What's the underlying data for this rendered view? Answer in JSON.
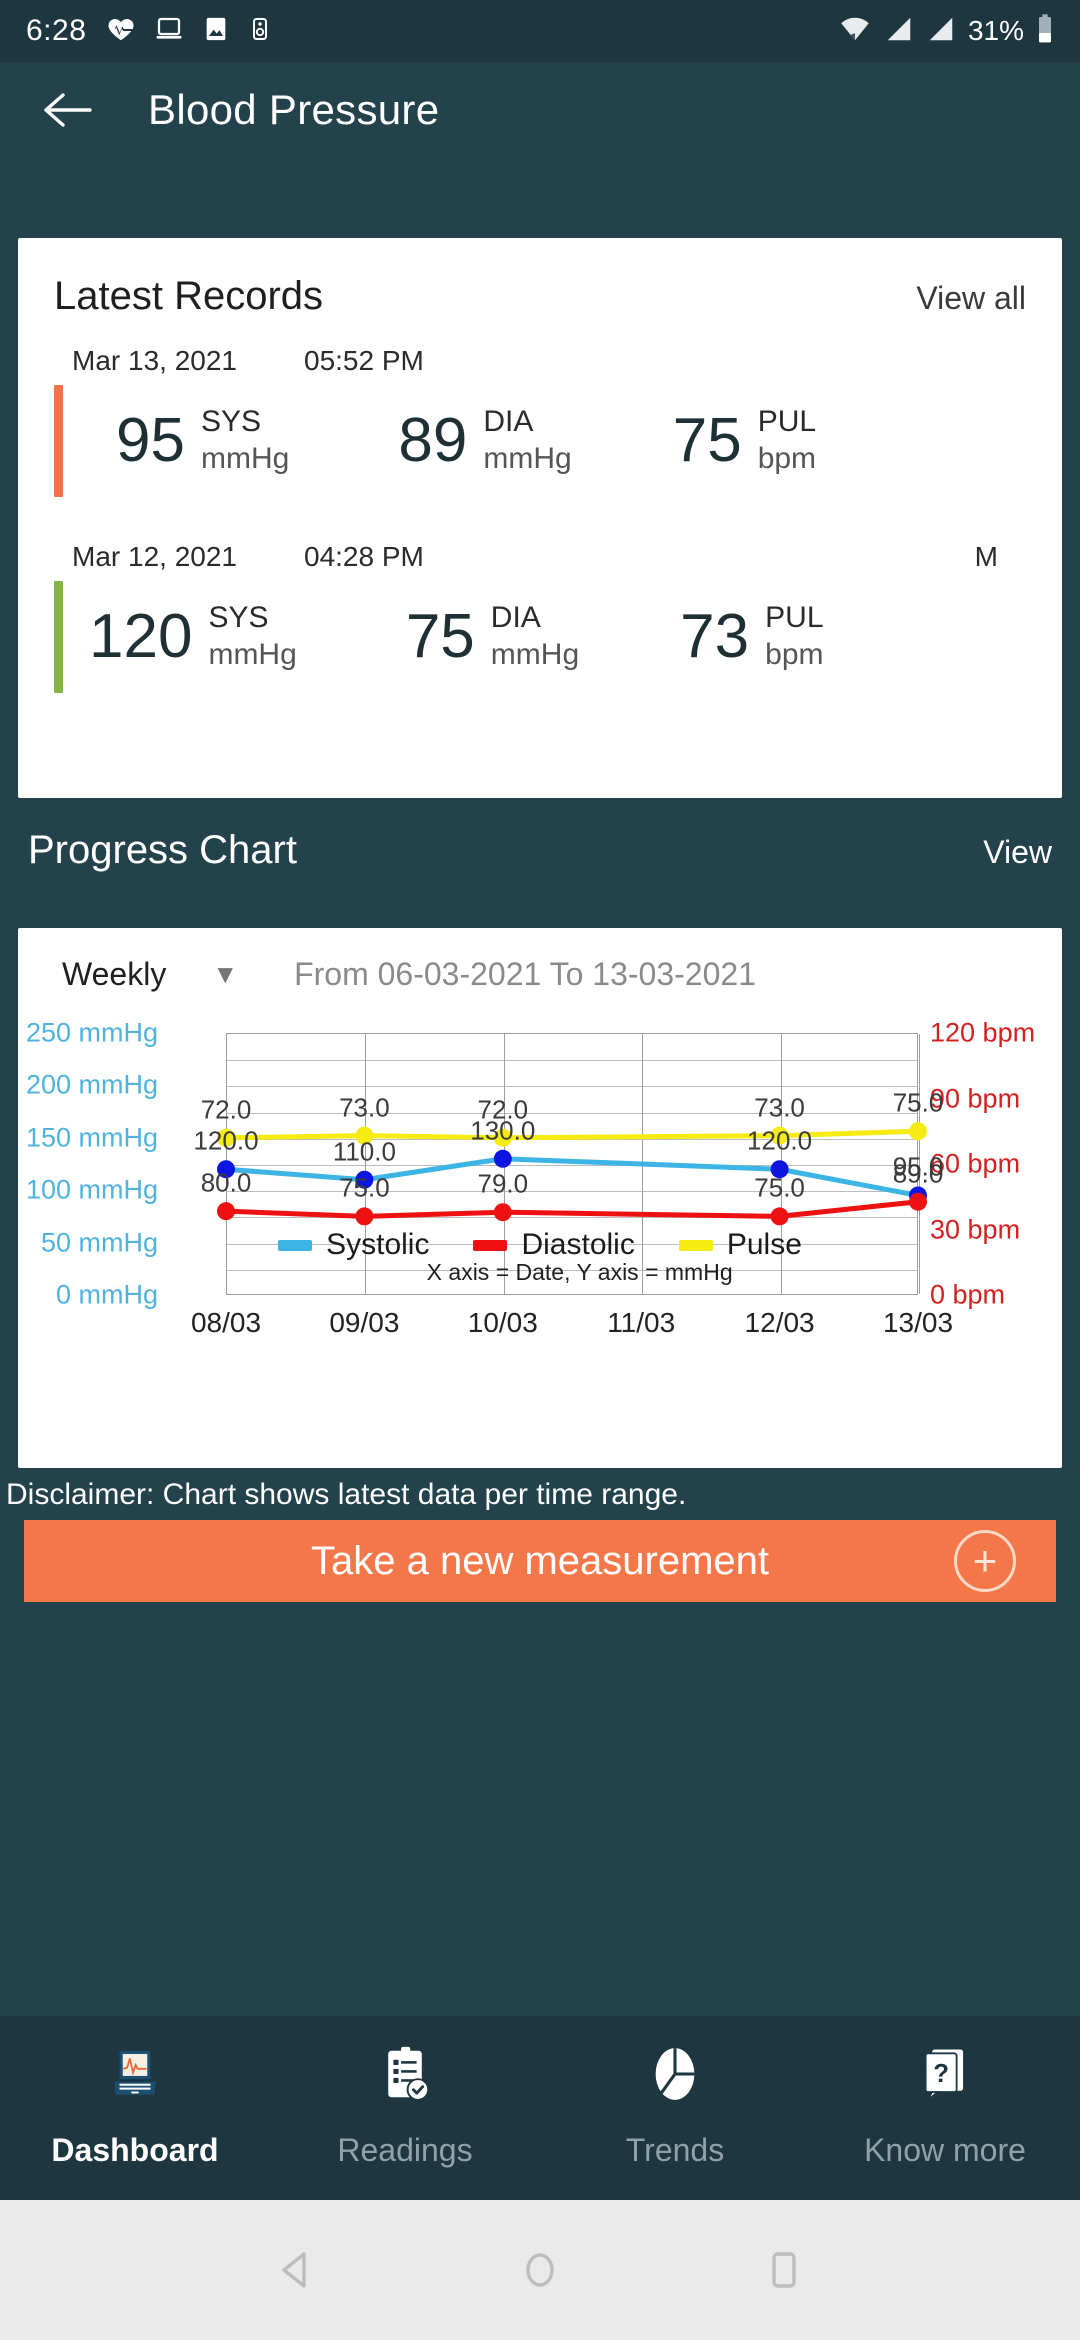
{
  "status_bar": {
    "time": "6:28",
    "battery_percent": "31%",
    "left_icons": [
      "heart-rate-icon",
      "laptop-icon",
      "image-icon",
      "speaker-icon"
    ],
    "right_icons": [
      "wifi-icon",
      "signal-1-icon",
      "signal-2-icon",
      "battery-icon"
    ]
  },
  "app_bar": {
    "back_icon": "back-arrow-icon",
    "title": "Blood Pressure"
  },
  "latest_records": {
    "title": "Latest Records",
    "view_all_label": "View all",
    "records": [
      {
        "date": "Mar 13, 2021",
        "time": "05:52 PM",
        "flag": "",
        "accent_color": "#f4724a",
        "metrics": [
          {
            "value": "95",
            "label": "SYS",
            "unit": "mmHg"
          },
          {
            "value": "89",
            "label": "DIA",
            "unit": "mmHg"
          },
          {
            "value": "75",
            "label": "PUL",
            "unit": "bpm"
          }
        ]
      },
      {
        "date": "Mar 12, 2021",
        "time": "04:28 PM",
        "flag": "M",
        "accent_color": "#82b541",
        "metrics": [
          {
            "value": "120",
            "label": "SYS",
            "unit": "mmHg"
          },
          {
            "value": "75",
            "label": "DIA",
            "unit": "mmHg"
          },
          {
            "value": "73",
            "label": "PUL",
            "unit": "bpm"
          }
        ]
      }
    ]
  },
  "progress_chart": {
    "section_title": "Progress Chart",
    "section_action": "View",
    "range_selector": {
      "value": "Weekly",
      "caret_icon": "chevron-down-icon"
    },
    "date_range": "From 06-03-2021  To 13-03-2021"
  },
  "chart_data": {
    "type": "line",
    "title": "",
    "xlabel": "Date",
    "ylabel": "mmHg",
    "axis_note": "X axis = Date, Y axis = mmHg",
    "categories": [
      "08/03",
      "09/03",
      "10/03",
      "11/03",
      "12/03",
      "13/03"
    ],
    "left_axis": {
      "ticks": [
        "0 mmHg",
        "50 mmHg",
        "100 mmHg",
        "150 mmHg",
        "200 mmHg",
        "250 mmHg"
      ],
      "values": [
        0,
        50,
        100,
        150,
        200,
        250
      ],
      "ylim": [
        0,
        250
      ],
      "color": "#4fb3de"
    },
    "right_axis": {
      "ticks": [
        "0 bpm",
        "30 bpm",
        "60 bpm",
        "90 bpm",
        "120 bpm"
      ],
      "values": [
        0,
        30,
        60,
        90,
        120
      ],
      "ylim": [
        0,
        120
      ],
      "color": "#d32020"
    },
    "grid": true,
    "legend_position": "bottom",
    "series": [
      {
        "name": "Systolic",
        "color": "#3cb4e5",
        "marker_color": "#0d16e0",
        "axis": "left",
        "values": [
          120.0,
          110.0,
          130.0,
          null,
          120.0,
          95.0
        ],
        "labels": [
          "120.0",
          "110.0",
          "130.0",
          "",
          "120.0",
          "95.0"
        ]
      },
      {
        "name": "Diastolic",
        "color": "#ee1111",
        "marker_color": "#ee1111",
        "axis": "left",
        "values": [
          80.0,
          75.0,
          79.0,
          null,
          75.0,
          89.0
        ],
        "labels": [
          "80.0",
          "75.0",
          "79.0",
          "",
          "75.0",
          "89.0"
        ]
      },
      {
        "name": "Pulse",
        "color": "#f6eb13",
        "marker_color": "#f6eb13",
        "axis": "right",
        "values": [
          72.0,
          73.0,
          72.0,
          null,
          73.0,
          75.0
        ],
        "labels": [
          "72.0",
          "73.0",
          "72.0",
          "",
          "73.0",
          "75.0"
        ]
      }
    ]
  },
  "disclaimer": "Disclaimer: Chart shows latest data per time range.",
  "cta": {
    "label": "Take a new measurement",
    "icon": "plus-circle-icon",
    "color": "#f4774a"
  },
  "bottom_nav": {
    "items": [
      {
        "label": "Dashboard",
        "icon": "monitor-ecg-icon",
        "active": true
      },
      {
        "label": "Readings",
        "icon": "clipboard-check-icon",
        "active": false
      },
      {
        "label": "Trends",
        "icon": "pie-chart-icon",
        "active": false
      },
      {
        "label": "Know more",
        "icon": "question-book-icon",
        "active": false
      }
    ]
  },
  "system_nav": {
    "back_icon": "android-back-icon",
    "home_icon": "android-home-icon",
    "recents_icon": "android-recents-icon"
  }
}
